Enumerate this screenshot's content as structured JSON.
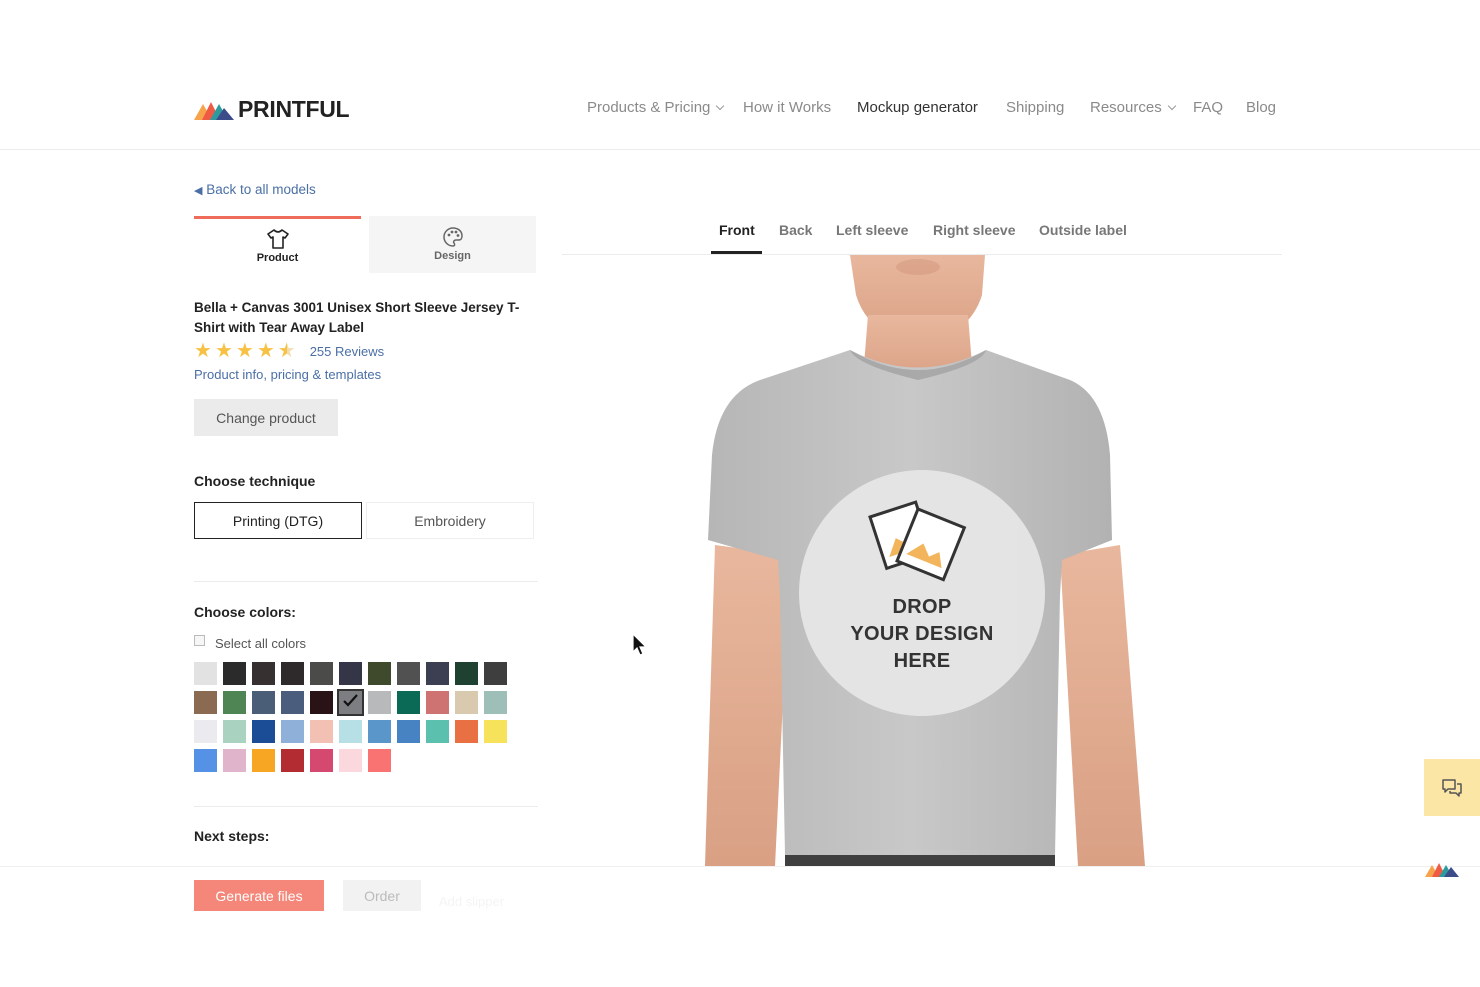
{
  "header": {
    "logo_text": "PRINTFUL",
    "nav": [
      {
        "label": "Products & Pricing",
        "dropdown": true
      },
      {
        "label": "How it Works",
        "dropdown": false
      },
      {
        "label": "Mockup generator",
        "dropdown": false,
        "active": true
      },
      {
        "label": "Shipping",
        "dropdown": false
      },
      {
        "label": "Resources",
        "dropdown": true
      },
      {
        "label": "FAQ",
        "dropdown": false
      },
      {
        "label": "Blog",
        "dropdown": false
      }
    ]
  },
  "left_panel": {
    "back_link": "Back to all models",
    "tabs": {
      "product": "Product",
      "design": "Design"
    },
    "product_title": "Bella + Canvas 3001 Unisex Short Sleeve Jersey T-Shirt with Tear Away Label",
    "rating": 4.5,
    "reviews": "255 Reviews",
    "info_link": "Product info, pricing & templates",
    "change_product": "Change product",
    "technique_heading": "Choose technique",
    "techniques": [
      "Printing (DTG)",
      "Embroidery"
    ],
    "colors_heading": "Choose colors:",
    "select_all": "Select all colors",
    "next_steps": "Next steps:",
    "generate_files": "Generate files",
    "order": "Order",
    "add_more": "Add slipper"
  },
  "colors": [
    "#e2e2e2",
    "#2b2b2b",
    "#363031",
    "#2e2a2c",
    "#4b4c49",
    "#343647",
    "#3f4a2c",
    "#505150",
    "#3c3f52",
    "#1f4132",
    "#3d3e3d",
    "#8a6a51",
    "#4f8554",
    "#4a5f77",
    "#4b5d7c",
    "#2a1316",
    "#7d7e82",
    "#b8b9ba",
    "#0a6a55",
    "#ce7372",
    "#d9c9ae",
    "#9dbfb7",
    "#ebebef",
    "#a9d2c0",
    "#1a4d95",
    "#8fb0d8",
    "#f2c1b3",
    "#b7e0e6",
    "#5b96cb",
    "#4783c2",
    "#5cc0ae",
    "#e87042",
    "#f7e35b",
    "#5591e4",
    "#e0b5cc",
    "#f6a623",
    "#b22c32",
    "#d5486f",
    "#fbd8dd",
    "#f87372"
  ],
  "selected_color_index": 16,
  "preview": {
    "tabs": [
      "Front",
      "Back",
      "Left sleeve",
      "Right sleeve",
      "Outside label"
    ],
    "active_tab": "Front",
    "drop_line1": "DROP",
    "drop_line2": "YOUR DESIGN",
    "drop_line3": "HERE",
    "shirt_color": "#c3c3c3"
  },
  "accent": "#ef6c5a",
  "link_color": "#4a6fa5"
}
